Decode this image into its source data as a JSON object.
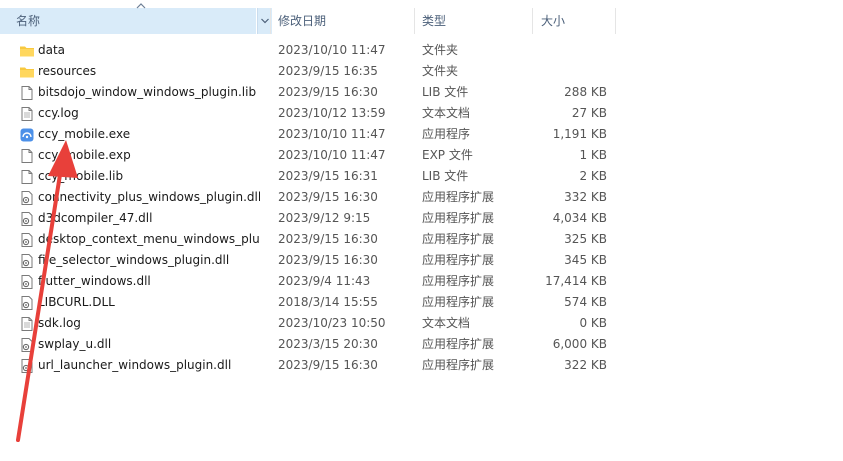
{
  "columns": {
    "name": "名称",
    "modified": "修改日期",
    "type": "类型",
    "size": "大小"
  },
  "files": [
    {
      "icon": "folder-icon",
      "name": "data",
      "modified": "2023/10/10 11:47",
      "type": "文件夹",
      "size": ""
    },
    {
      "icon": "folder-icon",
      "name": "resources",
      "modified": "2023/9/15 16:35",
      "type": "文件夹",
      "size": ""
    },
    {
      "icon": "file-icon",
      "name": "bitsdojo_window_windows_plugin.lib",
      "modified": "2023/9/15 16:30",
      "type": "LIB 文件",
      "size": "288 KB"
    },
    {
      "icon": "text-file-icon",
      "name": "ccy.log",
      "modified": "2023/10/12 13:59",
      "type": "文本文档",
      "size": "27 KB"
    },
    {
      "icon": "app-exe-icon",
      "name": "ccy_mobile.exe",
      "modified": "2023/10/10 11:47",
      "type": "应用程序",
      "size": "1,191 KB"
    },
    {
      "icon": "file-icon",
      "name": "ccy_mobile.exp",
      "modified": "2023/10/10 11:47",
      "type": "EXP 文件",
      "size": "1 KB"
    },
    {
      "icon": "file-icon",
      "name": "ccy_mobile.lib",
      "modified": "2023/9/15 16:31",
      "type": "LIB 文件",
      "size": "2 KB"
    },
    {
      "icon": "dll-icon",
      "name": "connectivity_plus_windows_plugin.dll",
      "modified": "2023/9/15 16:30",
      "type": "应用程序扩展",
      "size": "332 KB"
    },
    {
      "icon": "dll-icon",
      "name": "d3dcompiler_47.dll",
      "modified": "2023/9/12 9:15",
      "type": "应用程序扩展",
      "size": "4,034 KB"
    },
    {
      "icon": "dll-icon",
      "name": "desktop_context_menu_windows_plu...",
      "modified": "2023/9/15 16:30",
      "type": "应用程序扩展",
      "size": "325 KB"
    },
    {
      "icon": "dll-icon",
      "name": "file_selector_windows_plugin.dll",
      "modified": "2023/9/15 16:30",
      "type": "应用程序扩展",
      "size": "345 KB"
    },
    {
      "icon": "dll-icon",
      "name": "flutter_windows.dll",
      "modified": "2023/9/4 11:43",
      "type": "应用程序扩展",
      "size": "17,414 KB"
    },
    {
      "icon": "dll-icon",
      "name": "LIBCURL.DLL",
      "modified": "2018/3/14 15:55",
      "type": "应用程序扩展",
      "size": "574 KB"
    },
    {
      "icon": "text-file-icon",
      "name": "sdk.log",
      "modified": "2023/10/23 10:50",
      "type": "文本文档",
      "size": "0 KB"
    },
    {
      "icon": "dll-icon",
      "name": "swplay_u.dll",
      "modified": "2023/3/15 20:30",
      "type": "应用程序扩展",
      "size": "6,000 KB"
    },
    {
      "icon": "dll-icon",
      "name": "url_launcher_windows_plugin.dll",
      "modified": "2023/9/15 16:30",
      "type": "应用程序扩展",
      "size": "322 KB"
    }
  ],
  "colors": {
    "header_selected_bg": "#d9ebf9",
    "header_text": "#4c607a",
    "folder": "#f8c93f",
    "annotation_arrow": "#e8403a"
  }
}
